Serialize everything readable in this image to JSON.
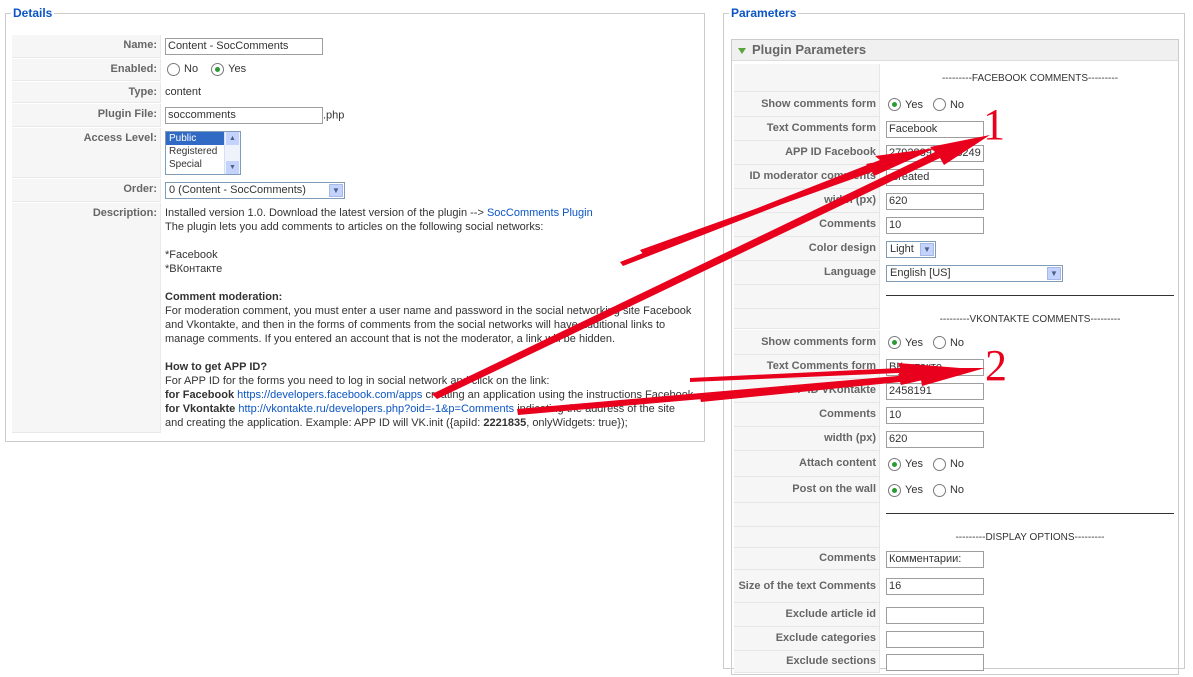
{
  "details": {
    "legend": "Details",
    "name_label": "Name:",
    "name_value": "Content - SocComments",
    "enabled_label": "Enabled:",
    "enabled_no": "No",
    "enabled_yes": "Yes",
    "type_label": "Type:",
    "type_value": "content",
    "plugin_file_label": "Plugin File:",
    "plugin_file_value": "soccomments",
    "plugin_file_ext": ".php",
    "access_label": "Access Level:",
    "access_options": [
      "Public",
      "Registered",
      "Special"
    ],
    "order_label": "Order:",
    "order_value": "0 (Content - SocComments)",
    "description_label": "Description:",
    "desc": {
      "line1_pre": "Installed version 1.0. Download the latest version of the plugin --> ",
      "line1_link": "SocComments Plugin",
      "line2": "The plugin lets you add comments to articles on the following social networks:",
      "net1": "*Facebook",
      "net2": "*ВКонтакте",
      "mod_title": "Comment moderation:",
      "mod_text": "For moderation comment, you must enter a user name and password in the social networking site Facebook and Vkontakte, and then in the forms of comments from the social networks will have additional links to manage comments. If you entered an account that is not the moderator, a link will be hidden.",
      "appid_title": "How to get APP ID?",
      "appid_text": "For APP ID for the forms you need to log in social network and click on the link:",
      "fb_label": "for Facebook",
      "fb_link": "https://developers.facebook.com/apps",
      "fb_after": " creating an application using the instructions Facebook",
      "vk_label": "for Vkontakte",
      "vk_link": "http://vkontakte.ru/developers.php?oid=-1&p=Comments",
      "vk_after": " indicating the address of the site",
      "last_pre": "and creating the application. Example: APP ID will VK.init ({apiId: ",
      "last_bold": "2221835",
      "last_post": ", onlyWidgets: true});"
    }
  },
  "params": {
    "legend": "Parameters",
    "panel_title": "Plugin Parameters",
    "fb_header": "---------FACEBOOK COMMENTS---------",
    "fb_show_label": "Show comments form",
    "fb_text_label": "Text Comments form",
    "fb_text_value": "Facebook",
    "fb_appid_label": "APP ID Facebook",
    "fb_appid_value": "279288925418249",
    "fb_moder_label": "ID moderator comments",
    "fb_moder_value": "rcreated",
    "fb_width_label": "width (px)",
    "fb_width_value": "620",
    "fb_comments_label": "Comments",
    "fb_comments_value": "10",
    "fb_color_label": "Color design",
    "fb_color_value": "Light",
    "fb_lang_label": "Language",
    "fb_lang_value": "English [US]",
    "vk_header": "---------VKONTAKTE COMMENTS---------",
    "vk_show_label": "Show comments form",
    "vk_text_label": "Text Comments form",
    "vk_text_value": "ВКонтакте",
    "vk_appid_label": "APP ID VKontakte",
    "vk_appid_value": "2458191",
    "vk_comments_label": "Comments",
    "vk_comments_value": "10",
    "vk_width_label": "width (px)",
    "vk_width_value": "620",
    "vk_attach_label": "Attach content",
    "vk_wall_label": "Post on the wall",
    "display_header": "---------DISPLAY OPTIONS---------",
    "disp_comments_label": "Comments",
    "disp_comments_value": "Комментарии:",
    "disp_size_label": "Size of the text Comments",
    "disp_size_value": "16",
    "excl_article_label": "Exclude article id",
    "excl_categories_label": "Exclude categories",
    "excl_sections_label": "Exclude sections",
    "yes": "Yes",
    "no": "No"
  },
  "annotations": {
    "one": "1",
    "two": "2",
    "arrow_color": "#e8001c"
  }
}
